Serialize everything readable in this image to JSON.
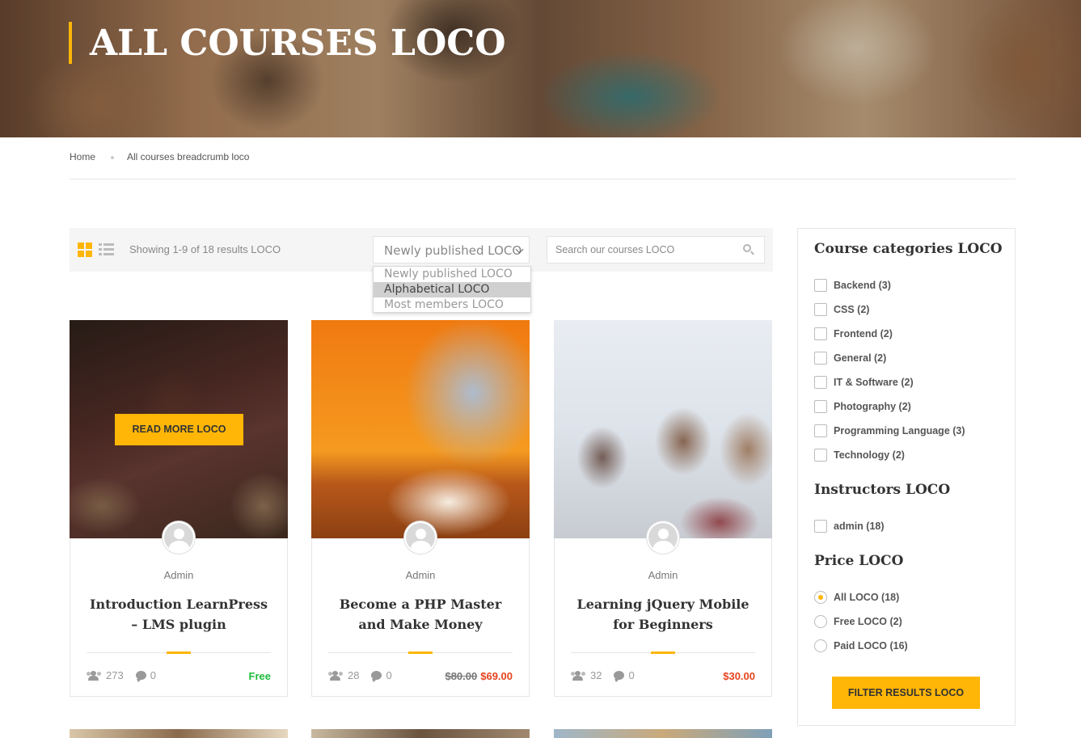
{
  "hero": {
    "title": "ALL COURSES LOCO"
  },
  "breadcrumb": {
    "home": "Home",
    "current": "All courses breadcrumb loco"
  },
  "toolbar": {
    "results_text": "Showing 1-9 of 18 results LOCO",
    "sort": {
      "selected": "Newly published LOCO",
      "options": [
        "Newly published LOCO",
        "Alphabetical LOCO",
        "Most members LOCO"
      ],
      "highlighted": "Alphabetical LOCO"
    },
    "search_placeholder": "Search our courses LOCO"
  },
  "colors": {
    "accent": "#ffb606",
    "free": "#1fbc3d",
    "sale": "#e5441e"
  },
  "courses": [
    {
      "author": "Admin",
      "title": "Introduction LearnPress – LMS plugin",
      "students": "273",
      "comments": "0",
      "price": "Free",
      "old_price": "",
      "hover_button": "READ MORE LOCO"
    },
    {
      "author": "Admin",
      "title": "Become a PHP Master and Make Money",
      "students": "28",
      "comments": "0",
      "price": "$69.00",
      "old_price": "$80.00"
    },
    {
      "author": "Admin",
      "title": "Learning jQuery Mobile for Beginners",
      "students": "32",
      "comments": "0",
      "price": "$30.00",
      "old_price": ""
    }
  ],
  "sidebar": {
    "categories_heading": "Course categories LOCO",
    "categories": [
      "Backend (3)",
      "CSS (2)",
      "Frontend (2)",
      "General (2)",
      "IT & Software (2)",
      "Photography (2)",
      "Programming Language (3)",
      "Technology (2)"
    ],
    "instructors_heading": "Instructors LOCO",
    "instructors": [
      "admin (18)"
    ],
    "price_heading": "Price LOCO",
    "price_options": [
      "All LOCO (18)",
      "Free LOCO (2)",
      "Paid LOCO (16)"
    ],
    "price_selected": "All LOCO (18)",
    "filter_button": "FILTER RESULTS LOCO"
  }
}
